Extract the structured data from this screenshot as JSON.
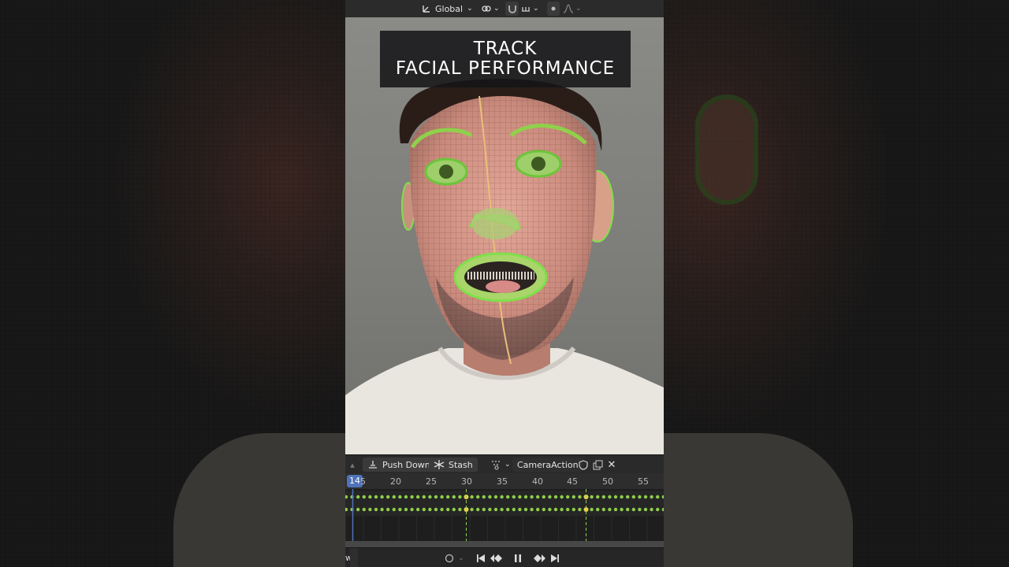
{
  "overlay": {
    "line1": "TRACK",
    "line2": "FACIAL PERFORMANCE"
  },
  "topbar": {
    "orientation_label": "Global"
  },
  "action_editor": {
    "push_down_label": "Push Down",
    "stash_label": "Stash",
    "action_name": "CameraAction"
  },
  "timeline": {
    "current_frame": "14",
    "current_frame_suffix": "5",
    "frame_labels": [
      "20",
      "25",
      "30",
      "35",
      "40",
      "45",
      "50",
      "55"
    ]
  },
  "playback": {
    "left_fragment": "w"
  },
  "colors": {
    "accent_blue": "#4f72b8",
    "mesh_green": "#7fe04a",
    "keyframe_green": "#8fcf4a",
    "keyframe_yellow": "#e8d24a",
    "marker_line": "#8fd14a"
  }
}
